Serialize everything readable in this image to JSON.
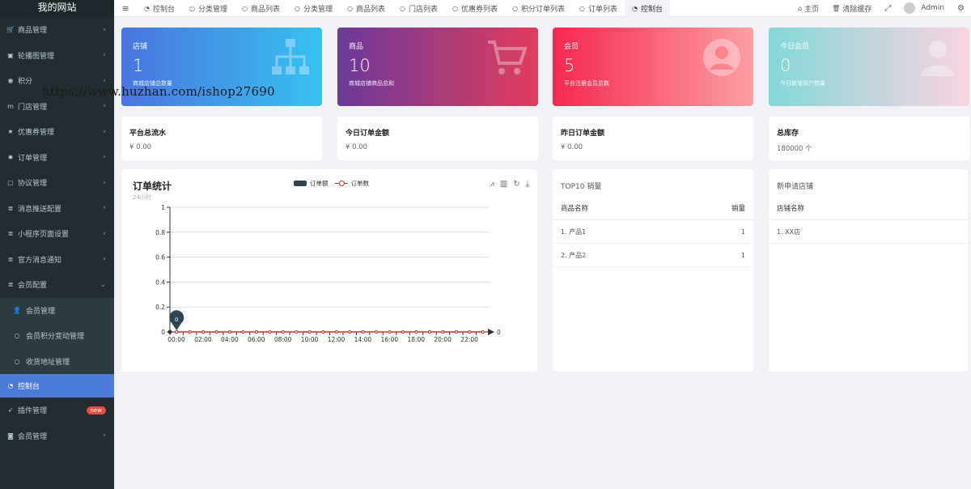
{
  "app": {
    "title": "我的网站"
  },
  "sidebar": {
    "items": [
      {
        "icon": "cart-icon",
        "glyph": "🛒",
        "label": "商品管理",
        "chevron": "‹"
      },
      {
        "icon": "image-icon",
        "glyph": "▣",
        "label": "轮播图管理",
        "chevron": "‹"
      },
      {
        "icon": "points-icon",
        "glyph": "◉",
        "label": "积分",
        "chevron": "‹"
      },
      {
        "icon": "store-m-icon",
        "glyph": "m",
        "label": "门店管理",
        "chevron": "‹"
      },
      {
        "icon": "star-icon",
        "glyph": "★",
        "label": "优惠券管理",
        "chevron": "‹"
      },
      {
        "icon": "gear-icon",
        "glyph": "✹",
        "label": "订单管理",
        "chevron": "‹"
      },
      {
        "icon": "doc-icon",
        "glyph": "▢",
        "label": "协议管理",
        "chevron": "‹"
      },
      {
        "icon": "list-icon",
        "glyph": "≣",
        "label": "消息推送配置",
        "chevron": "‹"
      },
      {
        "icon": "list-icon",
        "glyph": "≣",
        "label": "小程序页面设置",
        "chevron": "‹"
      },
      {
        "icon": "list-icon",
        "glyph": "≣",
        "label": "官方消息通知",
        "chevron": "‹"
      },
      {
        "icon": "list-icon",
        "glyph": "≣",
        "label": "会员配置",
        "chevron": "⌄"
      }
    ],
    "sub_items": [
      {
        "icon": "user-icon",
        "glyph": "👤",
        "label": "会员管理"
      },
      {
        "icon": "circle-icon",
        "glyph": "○",
        "label": "会员积分变动管理"
      },
      {
        "icon": "circle-icon",
        "glyph": "○",
        "label": "收货地址管理"
      }
    ],
    "active": {
      "icon": "dashboard-icon",
      "glyph": "◔",
      "label": "控制台"
    },
    "bottom": [
      {
        "icon": "rocket-icon",
        "glyph": "➶",
        "label": "插件管理",
        "badge": "new"
      },
      {
        "icon": "user-circle-icon",
        "glyph": "◙",
        "label": "会员管理",
        "chevron": "‹"
      }
    ]
  },
  "topbar": {
    "menu_glyph": "≡",
    "tabs": [
      {
        "icon": "dashboard-icon",
        "glyph": "◔",
        "label": "控制台",
        "active": false
      },
      {
        "icon": "circle-icon",
        "glyph": "○",
        "label": "分类管理",
        "active": false
      },
      {
        "icon": "circle-icon",
        "glyph": "○",
        "label": "商品列表",
        "active": false
      },
      {
        "icon": "circle-icon",
        "glyph": "○",
        "label": "分类管理",
        "active": false
      },
      {
        "icon": "circle-icon",
        "glyph": "○",
        "label": "商品列表",
        "active": false
      },
      {
        "icon": "circle-icon",
        "glyph": "○",
        "label": "门店列表",
        "active": false
      },
      {
        "icon": "circle-icon",
        "glyph": "○",
        "label": "优惠券列表",
        "active": false
      },
      {
        "icon": "circle-icon",
        "glyph": "○",
        "label": "积分订单列表",
        "active": false
      },
      {
        "icon": "circle-icon",
        "glyph": "○",
        "label": "订单列表",
        "active": false
      },
      {
        "icon": "dashboard-icon",
        "glyph": "◔",
        "label": "控制台",
        "active": true
      }
    ],
    "home": {
      "glyph": "⌂",
      "label": "主页"
    },
    "clear_cache": {
      "glyph": "🗑",
      "label": "清除缓存"
    },
    "fullscreen_glyph": "⤢",
    "user": {
      "name": "Admin"
    },
    "settings_glyph": "⚙"
  },
  "watermark": "https://www.huzhan.com/ishop27690",
  "cards": [
    {
      "label": "店铺",
      "value": "1",
      "sub": "商城店铺总数量",
      "icon": "sitemap-icon",
      "gradient": [
        "#4b74e0",
        "#35c3f0"
      ]
    },
    {
      "label": "商品",
      "value": "10",
      "sub": "商城店铺商品总和",
      "icon": "shopping-cart-icon",
      "gradient": [
        "#6a3a9a",
        "#e13d5c"
      ]
    },
    {
      "label": "会员",
      "value": "5",
      "sub": "平台注册会员总数",
      "icon": "user-circle-icon",
      "gradient": [
        "#f5284f",
        "#fc9fa3"
      ]
    },
    {
      "label": "今日会员",
      "value": "0",
      "sub": "今日新增用户数量",
      "icon": "user-icon",
      "gradient": [
        "#83d7d8",
        "#fbd4e1"
      ]
    }
  ],
  "stats": [
    {
      "label": "平台总流水",
      "value": "¥ 0.00"
    },
    {
      "label": "今日订单金额",
      "value": "¥ 0.00"
    },
    {
      "label": "昨日订单金额",
      "value": "¥ 0.00"
    },
    {
      "label": "总库存",
      "value": "180000 个"
    }
  ],
  "chart_panel": {
    "title": "订单统计",
    "subtitle": "24小时"
  },
  "chart_data": {
    "type": "line",
    "title": "订单统计",
    "subtitle": "24小时",
    "x": [
      "00:00",
      "01:00",
      "02:00",
      "03:00",
      "04:00",
      "05:00",
      "06:00",
      "07:00",
      "08:00",
      "09:00",
      "10:00",
      "11:00",
      "12:00",
      "13:00",
      "14:00",
      "15:00",
      "16:00",
      "17:00",
      "18:00",
      "19:00",
      "20:00",
      "21:00",
      "22:00",
      "23:00"
    ],
    "xticks": [
      "00:00",
      "02:00",
      "04:00",
      "06:00",
      "08:00",
      "10:00",
      "12:00",
      "14:00",
      "16:00",
      "18:00",
      "20:00",
      "22:00"
    ],
    "series": [
      {
        "name": "订单额",
        "type": "bar",
        "color": "#2f4554",
        "values": [
          0,
          0,
          0,
          0,
          0,
          0,
          0,
          0,
          0,
          0,
          0,
          0,
          0,
          0,
          0,
          0,
          0,
          0,
          0,
          0,
          0,
          0,
          0,
          0
        ]
      },
      {
        "name": "订单数",
        "type": "line",
        "color": "#c23531",
        "values": [
          0,
          0,
          0,
          0,
          0,
          0,
          0,
          0,
          0,
          0,
          0,
          0,
          0,
          0,
          0,
          0,
          0,
          0,
          0,
          0,
          0,
          0,
          0,
          0
        ]
      }
    ],
    "ylim": [
      0,
      1
    ],
    "yticks": [
      "0",
      "0.2",
      "0.4",
      "0.6",
      "0.8",
      "1"
    ],
    "y2_label": "0",
    "marker_label": "0",
    "grid": true,
    "legend": "top-center"
  },
  "top10": {
    "title": "TOP10 销量",
    "col_name": "商品名称",
    "col_sales": "销量",
    "rows": [
      {
        "name": "1. 产品1",
        "sales": "1"
      },
      {
        "name": "2. 产品2",
        "sales": "1"
      }
    ]
  },
  "new_stores": {
    "title": "新申请店铺",
    "col_name": "店铺名称",
    "rows": [
      {
        "name": "1. XX店"
      }
    ]
  }
}
